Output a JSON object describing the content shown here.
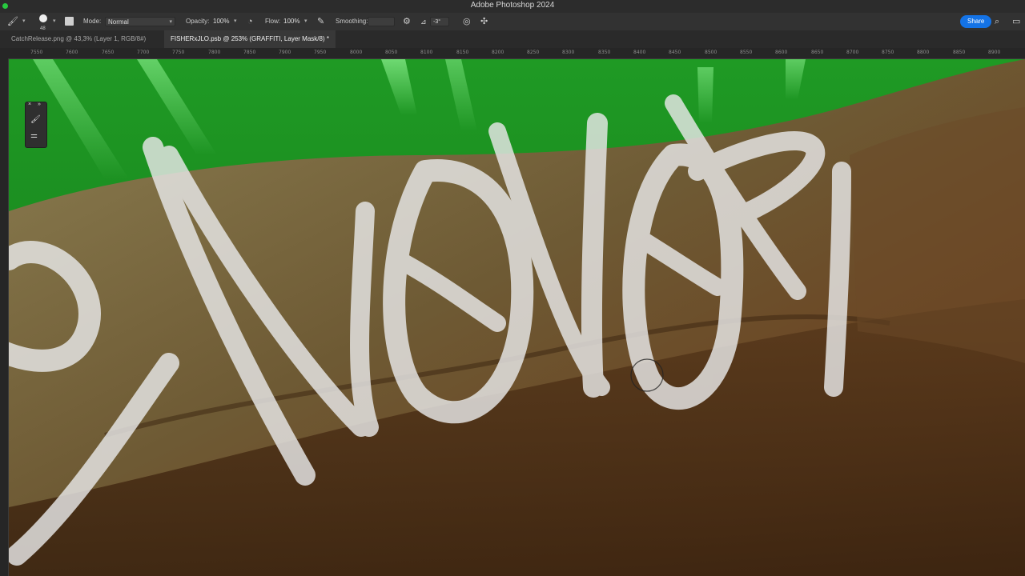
{
  "app": {
    "title": "Adobe Photoshop 2024"
  },
  "options_bar": {
    "brush_size": "48",
    "mode_label": "Mode:",
    "mode_value": "Normal",
    "opacity_label": "Opacity:",
    "opacity_value": "100%",
    "flow_label": "Flow:",
    "flow_value": "100%",
    "smoothing_label": "Smoothing:",
    "angle_value": "-3°",
    "share_label": "Share"
  },
  "tabs": [
    {
      "label": "CatchRelease.png @ 43,3% (Layer 1, RGB/8#)"
    },
    {
      "label": "FISHERxJLO.psb @ 253% (GRAFFITI, Layer Mask/8) *"
    }
  ],
  "ruler": {
    "ticks": [
      "7550",
      "7600",
      "7650",
      "7700",
      "7750",
      "7800",
      "7850",
      "7900",
      "7950",
      "8000",
      "8050",
      "8100",
      "8150",
      "8200",
      "8250",
      "8300",
      "8350",
      "8400",
      "8450",
      "8500",
      "8550",
      "8600",
      "8650",
      "8700",
      "8750",
      "8800",
      "8850",
      "8900"
    ]
  },
  "colors": {
    "accent": "#1473e6",
    "green_screen": "#1c8a1c",
    "graffiti": "#e8e8e8"
  },
  "icons": {
    "brush_tool": "brush-icon",
    "airbrush": "airbrush-icon",
    "settings": "gear-icon",
    "search": "search-icon"
  }
}
